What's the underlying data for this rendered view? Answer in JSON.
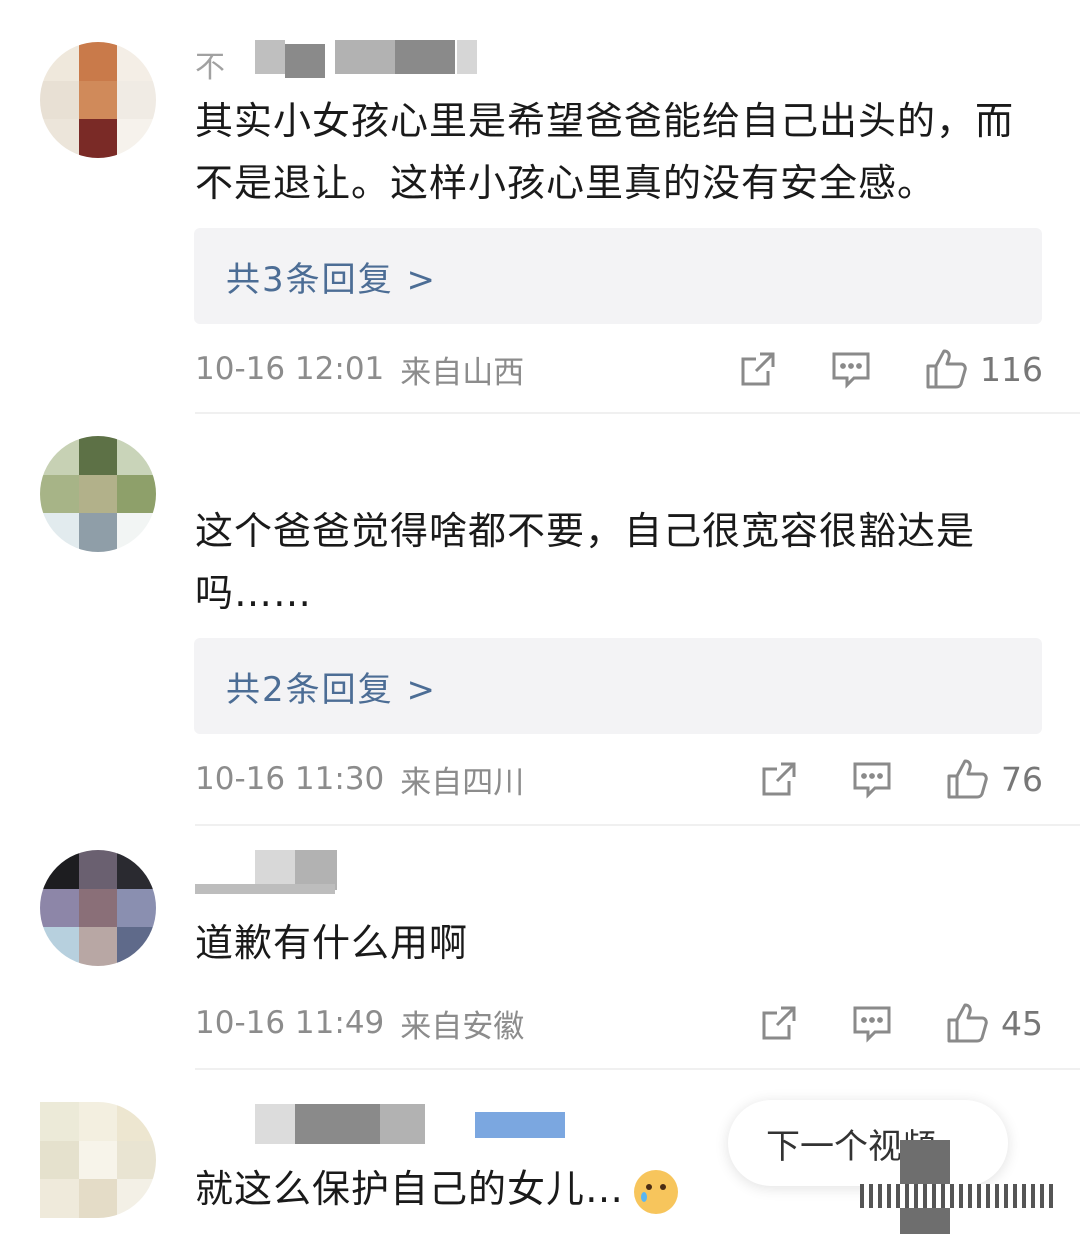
{
  "comments": [
    {
      "username": "不",
      "text": "其实小女孩心里是希望爸爸能给自己出头的，而不是退让。这样小孩心里真的没有安全感。",
      "replies": "共3条回复 >",
      "time": "10-16 12:01",
      "location": "来自山西",
      "likes": "116"
    },
    {
      "username": "",
      "text": "这个爸爸觉得啥都不要，自己很宽容很豁达是吗……",
      "replies": "共2条回复 >",
      "time": "10-16 11:30",
      "location": "来自四川",
      "likes": "76"
    },
    {
      "username": "",
      "text": "道歉有什么用啊",
      "time": "10-16 11:49",
      "location": "来自安徽",
      "likes": "45"
    },
    {
      "username": "",
      "text": "就这么保护自己的女儿…",
      "emoji": "crying-face-emoji"
    }
  ],
  "next_video": {
    "label": "下一个视频"
  },
  "icons": {
    "share": "share-icon",
    "reply": "comment-icon",
    "like": "thumbs-up-icon"
  },
  "colors": {
    "reply_link": "#4c6d95",
    "meta_text": "#8c8c8c",
    "reply_bg": "#f3f3f5"
  }
}
